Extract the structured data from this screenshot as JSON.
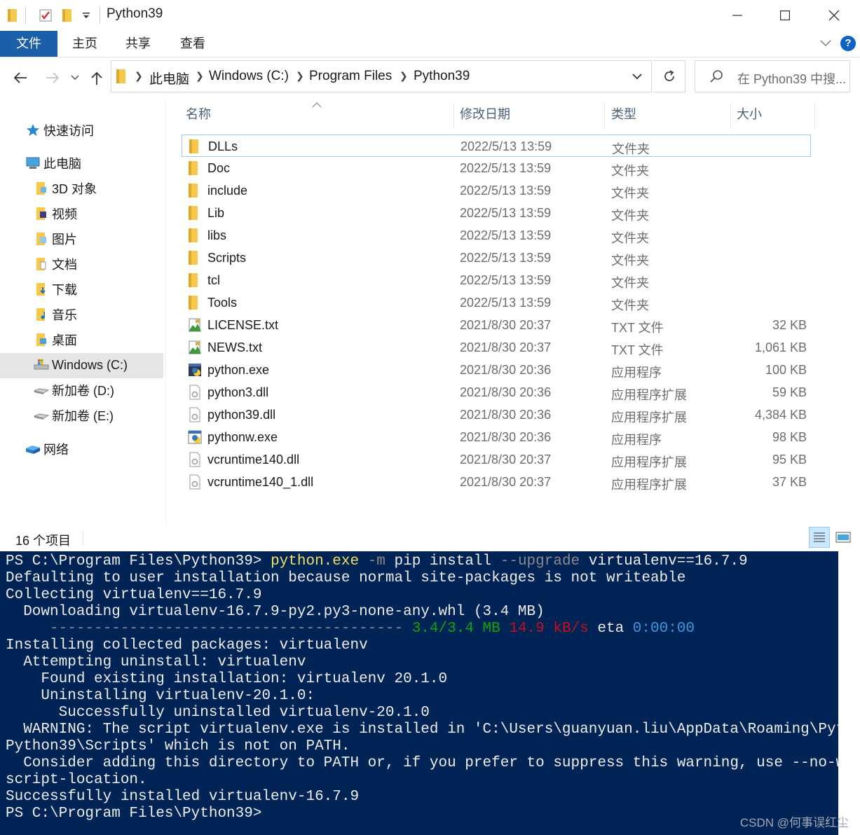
{
  "window": {
    "title": "Python39"
  },
  "ribbon": {
    "tabs": [
      "文件",
      "主页",
      "共享",
      "查看"
    ],
    "help": "?"
  },
  "address": {
    "crumbs": [
      "此电脑",
      "Windows (C:)",
      "Program Files",
      "Python39"
    ],
    "search_placeholder": "在 Python39 中搜..."
  },
  "navpane": {
    "items": [
      "快速访问",
      "此电脑",
      "3D 对象",
      "视频",
      "图片",
      "文档",
      "下载",
      "音乐",
      "桌面",
      "Windows (C:)",
      "新加卷 (D:)",
      "新加卷 (E:)",
      "网络"
    ],
    "selected": "Windows (C:)"
  },
  "columns": {
    "name": "名称",
    "date": "修改日期",
    "type": "类型",
    "size": "大小"
  },
  "files": [
    {
      "name": "DLLs",
      "date": "2022/5/13 13:59",
      "type": "文件夹",
      "size": "",
      "icon": "folder-icon"
    },
    {
      "name": "Doc",
      "date": "2022/5/13 13:59",
      "type": "文件夹",
      "size": "",
      "icon": "folder-icon"
    },
    {
      "name": "include",
      "date": "2022/5/13 13:59",
      "type": "文件夹",
      "size": "",
      "icon": "folder-icon"
    },
    {
      "name": "Lib",
      "date": "2022/5/13 13:59",
      "type": "文件夹",
      "size": "",
      "icon": "folder-icon"
    },
    {
      "name": "libs",
      "date": "2022/5/13 13:59",
      "type": "文件夹",
      "size": "",
      "icon": "folder-icon"
    },
    {
      "name": "Scripts",
      "date": "2022/5/13 13:59",
      "type": "文件夹",
      "size": "",
      "icon": "folder-icon"
    },
    {
      "name": "tcl",
      "date": "2022/5/13 13:59",
      "type": "文件夹",
      "size": "",
      "icon": "folder-icon"
    },
    {
      "name": "Tools",
      "date": "2022/5/13 13:59",
      "type": "文件夹",
      "size": "",
      "icon": "folder-icon"
    },
    {
      "name": "LICENSE.txt",
      "date": "2021/8/30 20:37",
      "type": "TXT 文件",
      "size": "32 KB",
      "icon": "text-file-icon"
    },
    {
      "name": "NEWS.txt",
      "date": "2021/8/30 20:37",
      "type": "TXT 文件",
      "size": "1,061 KB",
      "icon": "text-file-icon"
    },
    {
      "name": "python.exe",
      "date": "2021/8/30 20:36",
      "type": "应用程序",
      "size": "100 KB",
      "icon": "python-exe-icon"
    },
    {
      "name": "python3.dll",
      "date": "2021/8/30 20:36",
      "type": "应用程序扩展",
      "size": "59 KB",
      "icon": "dll-file-icon"
    },
    {
      "name": "python39.dll",
      "date": "2021/8/30 20:36",
      "type": "应用程序扩展",
      "size": "4,384 KB",
      "icon": "dll-file-icon"
    },
    {
      "name": "pythonw.exe",
      "date": "2021/8/30 20:36",
      "type": "应用程序",
      "size": "98 KB",
      "icon": "pythonw-exe-icon"
    },
    {
      "name": "vcruntime140.dll",
      "date": "2021/8/30 20:37",
      "type": "应用程序扩展",
      "size": "95 KB",
      "icon": "dll-file-icon"
    },
    {
      "name": "vcruntime140_1.dll",
      "date": "2021/8/30 20:37",
      "type": "应用程序扩展",
      "size": "37 KB",
      "icon": "dll-file-icon"
    }
  ],
  "status": {
    "count": "16 个项目"
  },
  "terminal": {
    "prompt1": "PS C:\\Program Files\\Python39> ",
    "cmd_exe": "python.exe",
    "cmd_flag1": " -m",
    "cmd_mid": " pip install ",
    "cmd_flag2": "--upgrade",
    "cmd_tail": " virtualenv==16.7.9",
    "l2": "Defaulting to user installation because normal site-packages is not writeable",
    "l3": "Collecting virtualenv==16.7.9",
    "l4": "  Downloading virtualenv-16.7.9-py2.py3-none-any.whl (3.4 MB)",
    "l5_bar": "     ---------------------------------------- ",
    "l5_size": "3.4/3.4 MB",
    "l5_speed": "14.9 kB/s",
    "l5_eta_label": " eta ",
    "l5_eta": "0:00:00",
    "l6": "Installing collected packages: virtualenv",
    "l7": "  Attempting uninstall: virtualenv",
    "l8": "    Found existing installation: virtualenv 20.1.0",
    "l9": "    Uninstalling virtualenv-20.1.0:",
    "l10": "      Successfully uninstalled virtualenv-20.1.0",
    "l11": "  WARNING: The script virtualenv.exe is installed in 'C:\\Users\\guanyuan.liu\\AppData\\Roaming\\Python\\",
    "l12": "Python39\\Scripts' which is not on PATH.",
    "l13": "  Consider adding this directory to PATH or, if you prefer to suppress this warning, use --no-warn-",
    "l14": "script-location.",
    "l15": "Successfully installed virtualenv-16.7.9",
    "l16": "PS C:\\Program Files\\Python39>"
  },
  "watermark": "CSDN @何事误红尘",
  "colors": {
    "terminal_bg": "#012456",
    "file_tab": "#1b5fa8",
    "selection_border": "#99c9ef",
    "folder": "#f8d775"
  }
}
